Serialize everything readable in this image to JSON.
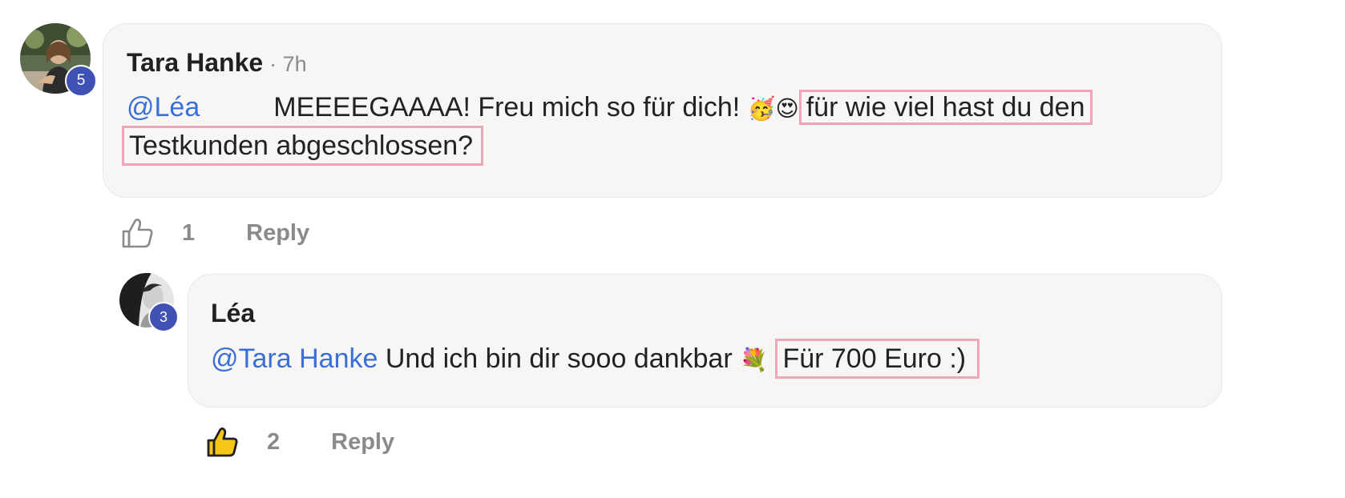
{
  "comment": {
    "author": "Tara Hanke",
    "meta": "· 7h",
    "level": "5",
    "mention": "@Léa",
    "text_main": "MEEEEGAAAA! Freu mich so für dich!",
    "emojis": "🥳😍",
    "highlight_1": "für wie viel hast du den",
    "highlight_2": "Testkunden abgeschlossen?",
    "like_count": "1",
    "reply_label": "Reply"
  },
  "reply": {
    "author": "Léa",
    "level": "3",
    "mention": "@Tara Hanke",
    "text_main": "Und ich bin dir sooo dankbar",
    "emoji": "💐",
    "highlight": "Für 700 Euro :)",
    "like_count": "2",
    "reply_label": "Reply"
  },
  "icons": {
    "like_outline": "thumbs-up-outline-icon",
    "like_filled": "thumbs-up-filled-icon"
  },
  "colors": {
    "mention": "#3b6fd8",
    "badge": "#3f51b5",
    "highlight_border": "#f0a6b8",
    "bubble": "#f7f6f5",
    "muted": "#8a8a8a"
  }
}
